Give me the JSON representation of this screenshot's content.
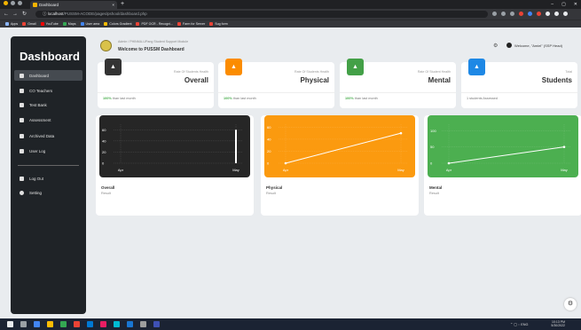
{
  "browser": {
    "tab_title": "Dashboard",
    "url_host": "localhost",
    "url_path": "/PUSSM-ACODE/pages/pshool/dashboard.php",
    "bookmarks": [
      {
        "label": "Apps",
        "color": "#8ab4f8"
      },
      {
        "label": "Gmail",
        "color": "#ea4335"
      },
      {
        "label": "YouTube",
        "color": "#ff0000"
      },
      {
        "label": "Maps",
        "color": "#34a853"
      },
      {
        "label": "User area",
        "color": "#4285f4"
      },
      {
        "label": "Colors Gradient",
        "color": "#fbbc05"
      },
      {
        "label": "PDF OCR - Recogni...",
        "color": "#ea4335"
      },
      {
        "label": "Farm for Server",
        "color": "#ea4335"
      },
      {
        "label": "Sug form",
        "color": "#ea4335"
      }
    ]
  },
  "sidebar": {
    "brand": "Dashboard",
    "items": [
      {
        "label": "Dashboard",
        "icon": "dashboard-icon"
      },
      {
        "label": "CO Teachers",
        "icon": "teachers-icon"
      },
      {
        "label": "Test Bank",
        "icon": "folder-icon"
      },
      {
        "label": "Assessment",
        "icon": "assessment-icon"
      },
      {
        "label": "Archived Data",
        "icon": "archive-icon"
      },
      {
        "label": "User Log",
        "icon": "user-icon"
      }
    ],
    "bottom_items": [
      {
        "label": "Log Out",
        "icon": "logout-icon"
      },
      {
        "label": "Setting",
        "icon": "gear-icon"
      }
    ]
  },
  "header": {
    "breadcrumb_home": "Admin",
    "breadcrumb_current": "PHINMA-UPang Student Support Module",
    "title": "Welcome to PUSSM Dashboard",
    "user": "Welcome, \"Amiel\" (SSP Head)"
  },
  "stats": [
    {
      "small": "Rate Of Students Health",
      "big": "Overall",
      "foot_pct": "100%",
      "foot_text": "than last month",
      "color": "#333333"
    },
    {
      "small": "Rate Of Students Health",
      "big": "Physical",
      "foot_pct": "100%",
      "foot_text": "than last month",
      "color": "#fb8c00"
    },
    {
      "small": "Rate Of Student Health",
      "big": "Mental",
      "foot_pct": "100%",
      "foot_text": "than last month",
      "color": "#43a047"
    },
    {
      "small": "Total",
      "big": "Students",
      "foot_pct": "",
      "foot_text": "1 students Assessed",
      "color": "#1e88e5"
    }
  ],
  "chart_cards": [
    {
      "title": "Overall",
      "sub": "Result",
      "bg": "#262626"
    },
    {
      "title": "Physical",
      "sub": "Result",
      "bg": "#fb9a0f"
    },
    {
      "title": "Mental",
      "sub": "Result",
      "bg": "#4caf50"
    }
  ],
  "chart_data": [
    {
      "type": "bar",
      "categories": [
        "Apr",
        "May"
      ],
      "values": [
        0,
        60
      ],
      "ylim": [
        0,
        70
      ],
      "yticks": [
        "0",
        "20",
        "40",
        "60"
      ]
    },
    {
      "type": "line",
      "categories": [
        "Apr",
        "May"
      ],
      "values": [
        0,
        50
      ],
      "ylim": [
        0,
        65
      ],
      "yticks": [
        "0",
        "20",
        "40",
        "60"
      ]
    },
    {
      "type": "line",
      "categories": [
        "Apr",
        "May"
      ],
      "values": [
        0,
        50
      ],
      "ylim": [
        0,
        120
      ],
      "yticks": [
        "0",
        "50",
        "100"
      ]
    }
  ]
}
